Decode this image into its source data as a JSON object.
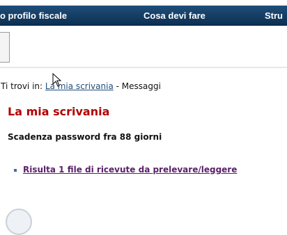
{
  "topnav": {
    "items": [
      {
        "label": "o profilo fiscale"
      },
      {
        "label": "Cosa devi fare"
      },
      {
        "label": "Stru"
      }
    ]
  },
  "breadcrumb": {
    "prefix": "Ti trovi in:",
    "link": "La mia scrivania",
    "separator": " - ",
    "current": "Messaggi"
  },
  "page": {
    "title": "La mia scrivania",
    "password_notice": "Scadenza password fra 88 giorni",
    "message_link": "Risulta 1 file di ricevute da prelevare/leggere"
  },
  "colors": {
    "nav_bg": "#1f4e79",
    "title": "#b30000",
    "link": "#1f4e79",
    "visited_link": "#5a1f6b"
  }
}
